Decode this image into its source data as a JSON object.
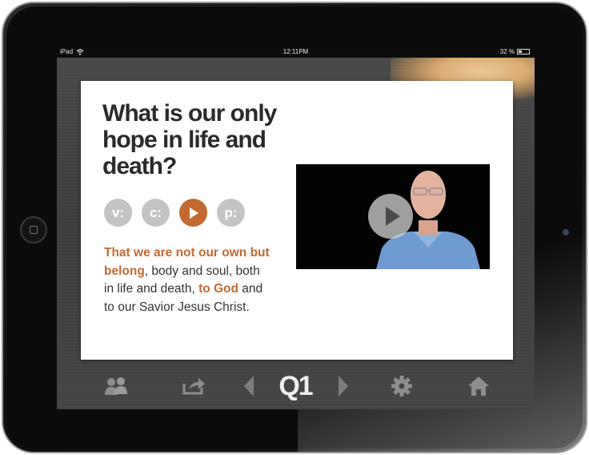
{
  "status_bar": {
    "device": "iPad",
    "time": "12:11PM",
    "battery": "32 %",
    "battery_level": 0.32
  },
  "card": {
    "question": "What is our only hope in life and death?",
    "modes": [
      {
        "label": "v:",
        "active": false
      },
      {
        "label": "c:",
        "active": false
      },
      {
        "label": "play-icon",
        "active": true
      },
      {
        "label": "p:",
        "active": false
      }
    ],
    "answer": {
      "part1": "That we are not our own but belong",
      "part2": ", body and soul, both in life and death, ",
      "part3": "to God",
      "part4": " and to our Savior Jesus Christ."
    }
  },
  "toolbar": {
    "question_number": "Q1"
  },
  "colors": {
    "accent": "#c26a32",
    "card_bg": "#ffffff",
    "wood": "#444444",
    "disabled": "#c4c4c4"
  },
  "icons": [
    "wifi-icon",
    "users-icon",
    "share-icon",
    "prev-arrow-icon",
    "next-arrow-icon",
    "settings-gear-icon",
    "home-icon",
    "play-icon"
  ]
}
